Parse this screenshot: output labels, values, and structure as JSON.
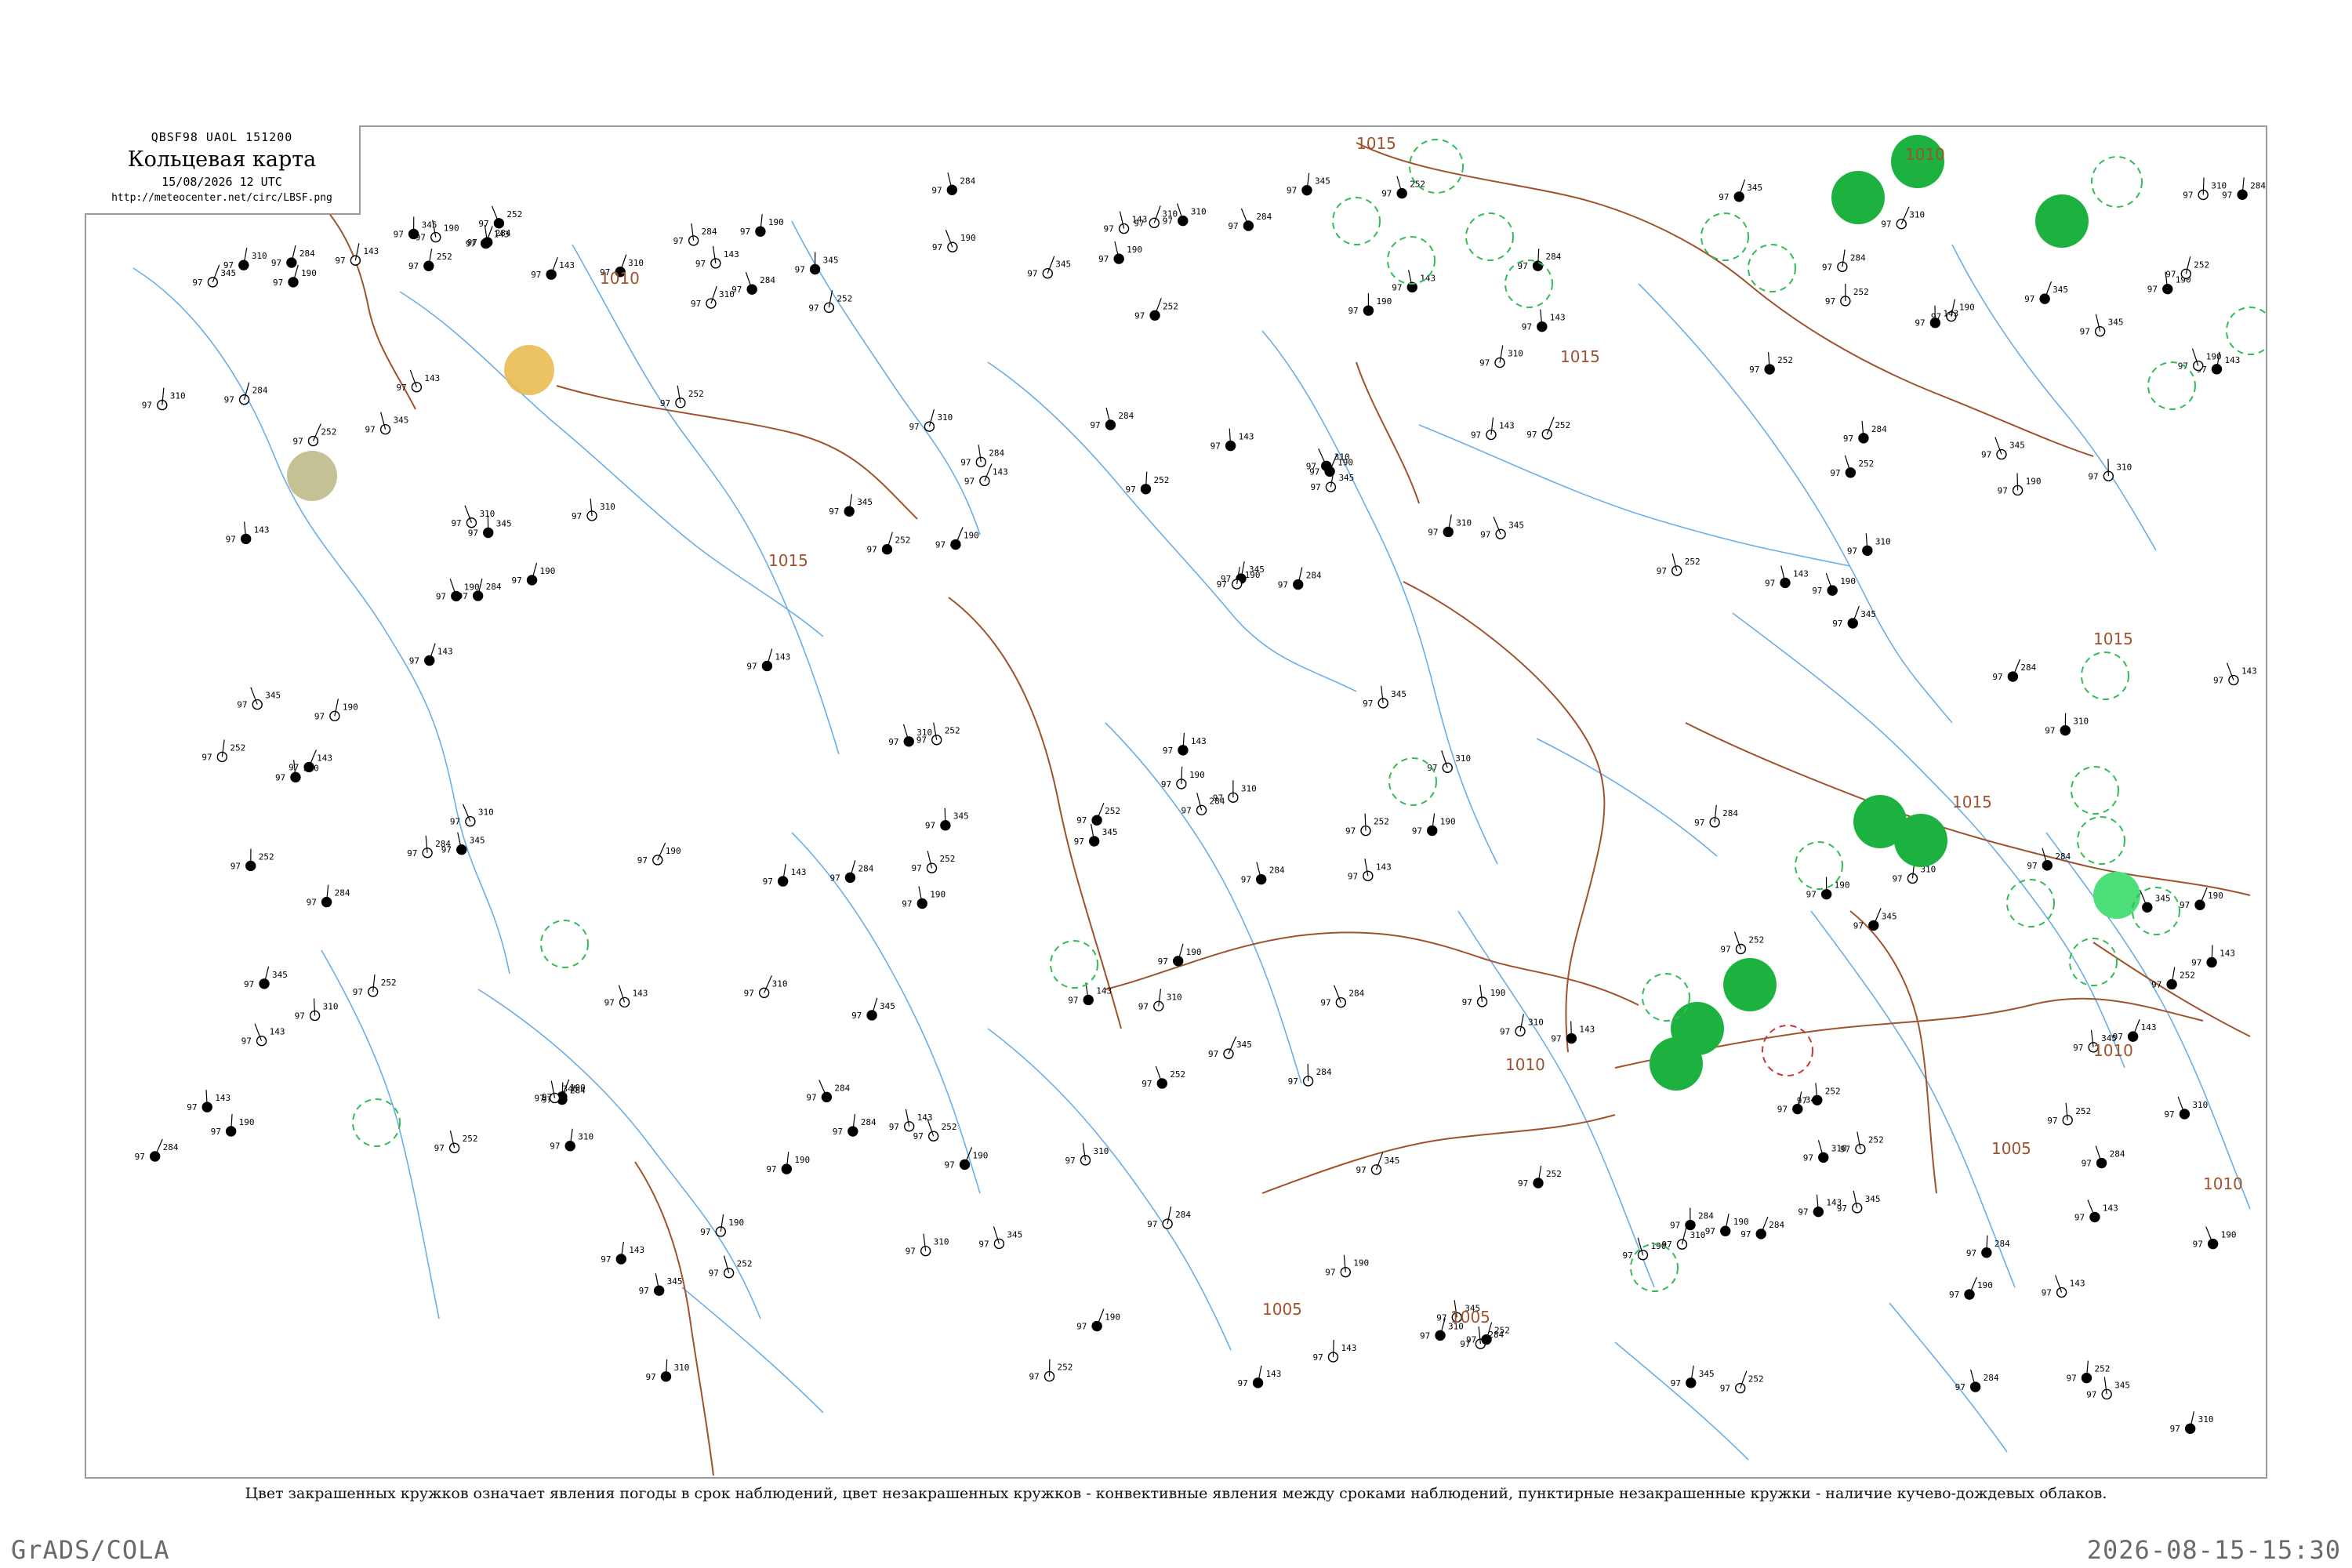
{
  "header": {
    "codes": "QBSF98  UAOL  151200",
    "title": "Кольцевая карта",
    "datetime": "15/08/2026 12 UTC",
    "url": "http://meteocenter.net/circ/LBSF.png"
  },
  "isobar_labels": [
    "1015",
    "1010",
    "1015",
    "1005",
    "1005",
    "1010",
    "1015",
    "1015",
    "1010",
    "1015",
    "1010",
    "1005",
    "1010"
  ],
  "highlight_colors": {
    "precip": "#22bb44",
    "thunder_dashed": "#33bb55",
    "dust": "#e8b84a",
    "fog": "#b5b27a",
    "isobar": "#a0522d",
    "rivers": "#5aa0e0",
    "alert_dashed": "#cc3333"
  },
  "stations_sample": [
    {
      "pressure": "143",
      "temp": "97"
    },
    {
      "pressure": "284",
      "temp": "97"
    },
    {
      "pressure": "190",
      "temp": "97"
    },
    {
      "pressure": "310",
      "temp": "97"
    },
    {
      "pressure": "345",
      "temp": "97"
    },
    {
      "pressure": "252",
      "temp": "97"
    }
  ],
  "caption": "Цвет закрашенных кружков означает явления погоды в срок наблюдений, цвет незакрашенных кружков - конвективные явления между сроками наблюдений, пунктирные незакрашенные кружки - наличие кучево-дождевых облаков.",
  "footer": {
    "left": "GrADS/COLA",
    "right": "2026-08-15-15:30"
  }
}
